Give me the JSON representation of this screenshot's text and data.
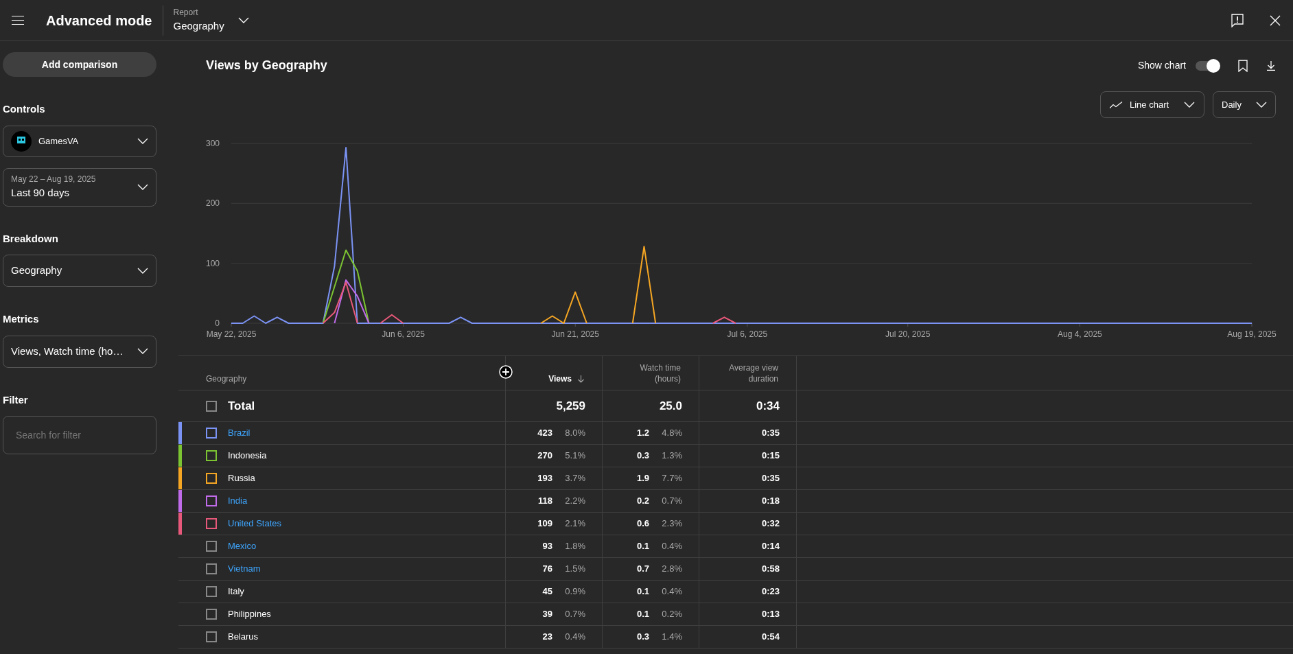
{
  "top_bar": {
    "title": "Advanced mode",
    "report_label": "Report",
    "report_value": "Geography"
  },
  "sidebar": {
    "add_comparison": "Add comparison",
    "controls": {
      "heading": "Controls",
      "channel": "GamesVA",
      "date_range": "May 22 – Aug 19, 2025",
      "period": "Last 90 days"
    },
    "breakdown": {
      "heading": "Breakdown",
      "value": "Geography"
    },
    "metrics": {
      "heading": "Metrics",
      "value": "Views, Watch time (ho…"
    },
    "filter": {
      "heading": "Filter",
      "placeholder": "Search for filter"
    }
  },
  "report": {
    "title": "Views by Geography",
    "show_chart": {
      "label": "Show chart",
      "on": true
    },
    "chart_type": "Line chart",
    "interval": "Daily",
    "chart_data": {
      "type": "line",
      "ylim": [
        0,
        300
      ],
      "yticks": [
        0,
        100,
        200,
        300
      ],
      "categories": [
        "May 22, 2025",
        null,
        null,
        null,
        null,
        null,
        null,
        null,
        null,
        null,
        null,
        null,
        null,
        null,
        null,
        "Jun 6, 2025",
        null,
        null,
        null,
        null,
        null,
        null,
        null,
        null,
        null,
        null,
        null,
        null,
        null,
        null,
        "Jun 21, 2025",
        null,
        null,
        null,
        null,
        null,
        null,
        null,
        null,
        null,
        null,
        null,
        null,
        null,
        null,
        "Jul 6, 2025",
        null,
        null,
        null,
        null,
        null,
        null,
        null,
        null,
        null,
        null,
        null,
        null,
        null,
        "Jul 20, 2025",
        null,
        null,
        null,
        null,
        null,
        null,
        null,
        null,
        null,
        null,
        null,
        null,
        null,
        null,
        "Aug 4, 2025",
        null,
        null,
        null,
        null,
        null,
        null,
        null,
        null,
        null,
        null,
        null,
        null,
        null,
        null,
        "Aug 19, 2025"
      ],
      "series": [
        {
          "color": "#7b93f4",
          "values": [
            0,
            0,
            12,
            0,
            10,
            0,
            0,
            0,
            0,
            95,
            293,
            0,
            0,
            0,
            0,
            0,
            0,
            0,
            0,
            0,
            10,
            0,
            0,
            0,
            0,
            0,
            0,
            0,
            0,
            0,
            0,
            0,
            0,
            0,
            0,
            0,
            0,
            0,
            0,
            0,
            0,
            0,
            0,
            0,
            0,
            0,
            0,
            0,
            0,
            0,
            0,
            0,
            0,
            0,
            0,
            0,
            0,
            0,
            0,
            0,
            0,
            0,
            0,
            0,
            0,
            0,
            0,
            0,
            0,
            0,
            0,
            0,
            0,
            0,
            0,
            0,
            0,
            0,
            0,
            0,
            0,
            0,
            0,
            0,
            0,
            0,
            0,
            0,
            0,
            0
          ]
        },
        {
          "color": "#7cc432",
          "values": [
            null,
            null,
            null,
            null,
            null,
            null,
            null,
            null,
            0,
            61,
            122,
            87,
            0,
            null,
            null,
            null,
            null,
            null,
            null,
            null,
            null,
            null,
            null,
            null,
            null,
            null,
            null,
            null,
            null,
            null,
            null,
            null,
            null,
            null,
            null,
            null,
            null,
            null,
            null,
            null,
            null,
            null,
            null,
            null,
            null,
            null,
            null,
            null,
            null,
            null,
            null,
            null,
            null,
            null,
            null,
            null,
            null,
            null,
            null,
            null,
            null,
            null,
            null,
            null,
            null,
            null,
            null,
            null,
            null,
            null,
            null,
            null,
            null,
            null,
            null,
            null,
            null,
            null,
            null,
            null,
            null,
            null,
            null,
            null,
            null,
            null,
            null,
            null,
            null,
            null
          ]
        },
        {
          "color": "#f5a623",
          "values": [
            null,
            null,
            null,
            null,
            null,
            null,
            null,
            null,
            null,
            null,
            null,
            null,
            null,
            null,
            null,
            null,
            null,
            null,
            null,
            null,
            null,
            null,
            null,
            null,
            null,
            null,
            null,
            0,
            12,
            0,
            52,
            0,
            null,
            null,
            null,
            0,
            128,
            0,
            null,
            null,
            null,
            null,
            null,
            null,
            null,
            null,
            null,
            null,
            null,
            null,
            null,
            null,
            null,
            null,
            null,
            null,
            null,
            null,
            null,
            null,
            null,
            null,
            null,
            null,
            null,
            null,
            null,
            null,
            null,
            null,
            null,
            null,
            null,
            null,
            null,
            null,
            null,
            null,
            null,
            null,
            null,
            null,
            null,
            null,
            null,
            null,
            null,
            null,
            null,
            null
          ]
        },
        {
          "color": "#c06bea",
          "values": [
            null,
            null,
            null,
            null,
            null,
            null,
            null,
            null,
            null,
            0,
            72,
            45,
            0,
            null,
            null,
            null,
            null,
            null,
            null,
            null,
            null,
            null,
            null,
            null,
            null,
            null,
            null,
            null,
            null,
            null,
            null,
            null,
            null,
            null,
            null,
            null,
            null,
            null,
            null,
            null,
            null,
            null,
            null,
            null,
            null,
            null,
            null,
            null,
            null,
            null,
            null,
            null,
            null,
            null,
            null,
            null,
            null,
            null,
            null,
            null,
            null,
            null,
            null,
            null,
            null,
            null,
            null,
            null,
            null,
            null,
            null,
            null,
            null,
            null,
            null,
            null,
            null,
            null,
            null,
            null,
            null,
            null,
            null,
            null,
            null,
            null,
            null,
            null,
            null,
            null
          ]
        },
        {
          "color": "#e8587a",
          "values": [
            null,
            null,
            null,
            null,
            null,
            null,
            null,
            null,
            0,
            18,
            68,
            0,
            null,
            0,
            14,
            0,
            null,
            null,
            null,
            null,
            null,
            null,
            null,
            null,
            null,
            null,
            null,
            null,
            null,
            null,
            null,
            null,
            null,
            null,
            null,
            null,
            null,
            null,
            null,
            null,
            null,
            null,
            0,
            10,
            0,
            null,
            null,
            null,
            null,
            null,
            null,
            null,
            null,
            null,
            null,
            null,
            null,
            null,
            null,
            null,
            null,
            null,
            null,
            null,
            null,
            null,
            null,
            null,
            null,
            null,
            null,
            null,
            null,
            null,
            null,
            null,
            null,
            null,
            null,
            null,
            null,
            null,
            null,
            null,
            null,
            null,
            null,
            null,
            null,
            null
          ]
        }
      ]
    }
  },
  "table": {
    "columns": [
      {
        "label": "Geography",
        "sorted": false
      },
      {
        "label": "Views",
        "sorted": true
      },
      {
        "label": "Watch time (hours)",
        "sorted": false
      },
      {
        "label": "Average view duration",
        "sorted": false
      }
    ],
    "total": {
      "label": "Total",
      "checked": false,
      "views": "5,259",
      "watch_time": "25.0",
      "avg_duration": "0:34"
    },
    "rows": [
      {
        "name": "Brazil",
        "link": true,
        "color": "#7b93f4",
        "checked": false,
        "views": "423",
        "views_pct": "8.0%",
        "watch_time": "1.2",
        "watch_pct": "4.8%",
        "avg_duration": "0:35"
      },
      {
        "name": "Indonesia",
        "link": false,
        "color": "#7cc432",
        "checked": false,
        "views": "270",
        "views_pct": "5.1%",
        "watch_time": "0.3",
        "watch_pct": "1.3%",
        "avg_duration": "0:15"
      },
      {
        "name": "Russia",
        "link": false,
        "color": "#f5a623",
        "checked": false,
        "views": "193",
        "views_pct": "3.7%",
        "watch_time": "1.9",
        "watch_pct": "7.7%",
        "avg_duration": "0:35"
      },
      {
        "name": "India",
        "link": true,
        "color": "#c06bea",
        "checked": false,
        "views": "118",
        "views_pct": "2.2%",
        "watch_time": "0.2",
        "watch_pct": "0.7%",
        "avg_duration": "0:18"
      },
      {
        "name": "United States",
        "link": true,
        "color": "#e8587a",
        "checked": false,
        "views": "109",
        "views_pct": "2.1%",
        "watch_time": "0.6",
        "watch_pct": "2.3%",
        "avg_duration": "0:32"
      },
      {
        "name": "Mexico",
        "link": true,
        "checked": false,
        "views": "93",
        "views_pct": "1.8%",
        "watch_time": "0.1",
        "watch_pct": "0.4%",
        "avg_duration": "0:14"
      },
      {
        "name": "Vietnam",
        "link": true,
        "checked": false,
        "views": "76",
        "views_pct": "1.5%",
        "watch_time": "0.7",
        "watch_pct": "2.8%",
        "avg_duration": "0:58"
      },
      {
        "name": "Italy",
        "link": false,
        "checked": false,
        "views": "45",
        "views_pct": "0.9%",
        "watch_time": "0.1",
        "watch_pct": "0.4%",
        "avg_duration": "0:23"
      },
      {
        "name": "Philippines",
        "link": false,
        "checked": false,
        "views": "39",
        "views_pct": "0.7%",
        "watch_time": "0.1",
        "watch_pct": "0.2%",
        "avg_duration": "0:13"
      },
      {
        "name": "Belarus",
        "link": false,
        "checked": false,
        "views": "23",
        "views_pct": "0.4%",
        "watch_time": "0.3",
        "watch_pct": "1.4%",
        "avg_duration": "0:54"
      }
    ]
  }
}
